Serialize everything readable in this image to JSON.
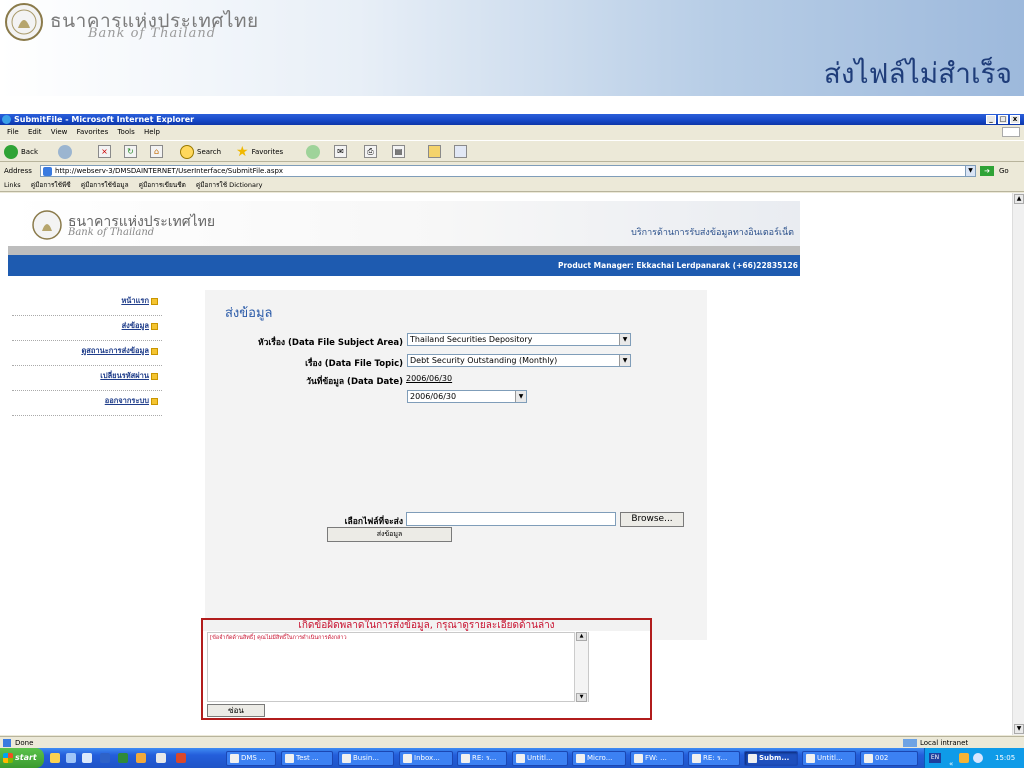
{
  "slide": {
    "bank_name_th": "ธนาคารแห่งประเทศไทย",
    "bank_name_en": "Bank of Thailand",
    "title": "ส่งไฟล์ไม่สำเร็จ"
  },
  "browser": {
    "window_title": "SubmitFile - Microsoft Internet Explorer",
    "window_buttons": [
      "_",
      "□",
      "x"
    ],
    "menu": [
      "File",
      "Edit",
      "View",
      "Favorites",
      "Tools",
      "Help"
    ],
    "toolbar": {
      "back": "Back",
      "search": "Search",
      "favorites": "Favorites"
    },
    "address_label": "Address",
    "address_value": "http://webserv-3/DMSDAINTERNET/UserInterface/SubmitFile.aspx",
    "go_label": "Go",
    "links_label": "Links",
    "links": [
      "คู่มือการใช้พีซี",
      "คู่มือการใช้ข้อมูล",
      "คู่มือการเขียนชีต",
      "คู่มือการใช้ Dictionary"
    ],
    "status_text": "Done",
    "zone_text": "Local intranet"
  },
  "site": {
    "bank_name_th": "ธนาคารแห่งประเทศไทย",
    "bank_name_en": "Bank of Thailand",
    "service_name": "บริการด้านการรับส่งข้อมูลทางอินเตอร์เน็ต",
    "product_manager": "Product Manager: Ekkachai Lerdpanarak (+66)22835126",
    "nav": [
      {
        "label": "หน้าแรก"
      },
      {
        "label": "ส่งข้อมูล"
      },
      {
        "label": "ดูสถานะการส่งข้อมูล"
      },
      {
        "label": "เปลี่ยนรหัสผ่าน"
      },
      {
        "label": "ออกจากระบบ"
      }
    ]
  },
  "form": {
    "title": "ส่งข้อมูล",
    "subject_label": "หัวเรื่อง (Data File Subject Area)",
    "subject_value": "Thailand Securities Depository",
    "topic_label": "เรื่อง (Data File Topic)",
    "topic_value": "Debt Security Outstanding (Monthly)",
    "date_label": "วันที่ข้อมูล (Data Date)",
    "date_link": "2006/06/30",
    "date_value": "2006/06/30",
    "file_label": "เลือกไฟล์ที่จะส่ง",
    "browse_label": "Browse...",
    "send_label": "ส่งข้อมูล"
  },
  "error": {
    "header": "เกิดข้อผิดพลาดในการส่งข้อมูล, กรุณาดูรายละเอียดด้านล่าง",
    "message": "[ข้อจำกัดด้านสิทธิ์] คุณไม่มีสิทธิ์ในการดำเนินการดังกล่าว",
    "hide_label": "ซ่อน"
  },
  "taskbar": {
    "start_label": "start",
    "items": [
      "DMS ...",
      "Test ...",
      "Busin...",
      "Inbox...",
      "RE: ร...",
      "Untitl...",
      "Micro...",
      "FW: ...",
      "RE: ร...",
      "Subm...",
      "Untitl...",
      "002"
    ],
    "active_index": 9,
    "tray_lang": "EN",
    "clock": "15:05"
  },
  "colors": {
    "slide_title": "#1f3d7a",
    "ie_titlebar": "#1547c6",
    "site_bluebar": "#1e5bb0",
    "error_red": "#c8102e",
    "taskbar": "#245edb"
  }
}
